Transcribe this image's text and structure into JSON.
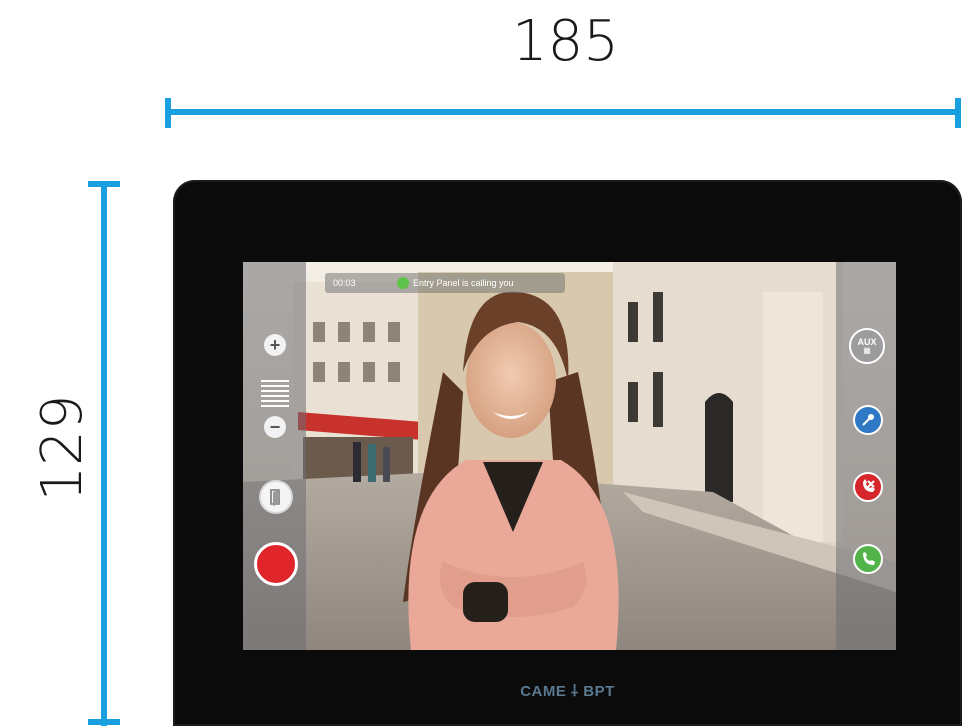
{
  "dimensions": {
    "width_label": "185",
    "height_label": "129",
    "line_color": "#1aa0e0"
  },
  "brand": {
    "name": "CAME ⸸ BPT"
  },
  "status_bar": {
    "timer": "00:03",
    "message": "Entry Panel is calling you",
    "indicator_color": "#5fc24a"
  },
  "left_controls": {
    "volume_up_icon": "plus-icon",
    "volume_down_icon": "minus-icon",
    "door_icon": "door-open-icon",
    "record_icon": "record-icon"
  },
  "right_controls": {
    "aux_label": "AUX",
    "aux_icon": "keypad-grid-icon",
    "key_icon": "key-icon",
    "reject_icon": "hang-up-icon",
    "answer_icon": "phone-icon"
  },
  "colors": {
    "record": "#e0262b",
    "key": "#2f78c4",
    "reject": "#d7262b",
    "answer": "#52b34a"
  }
}
